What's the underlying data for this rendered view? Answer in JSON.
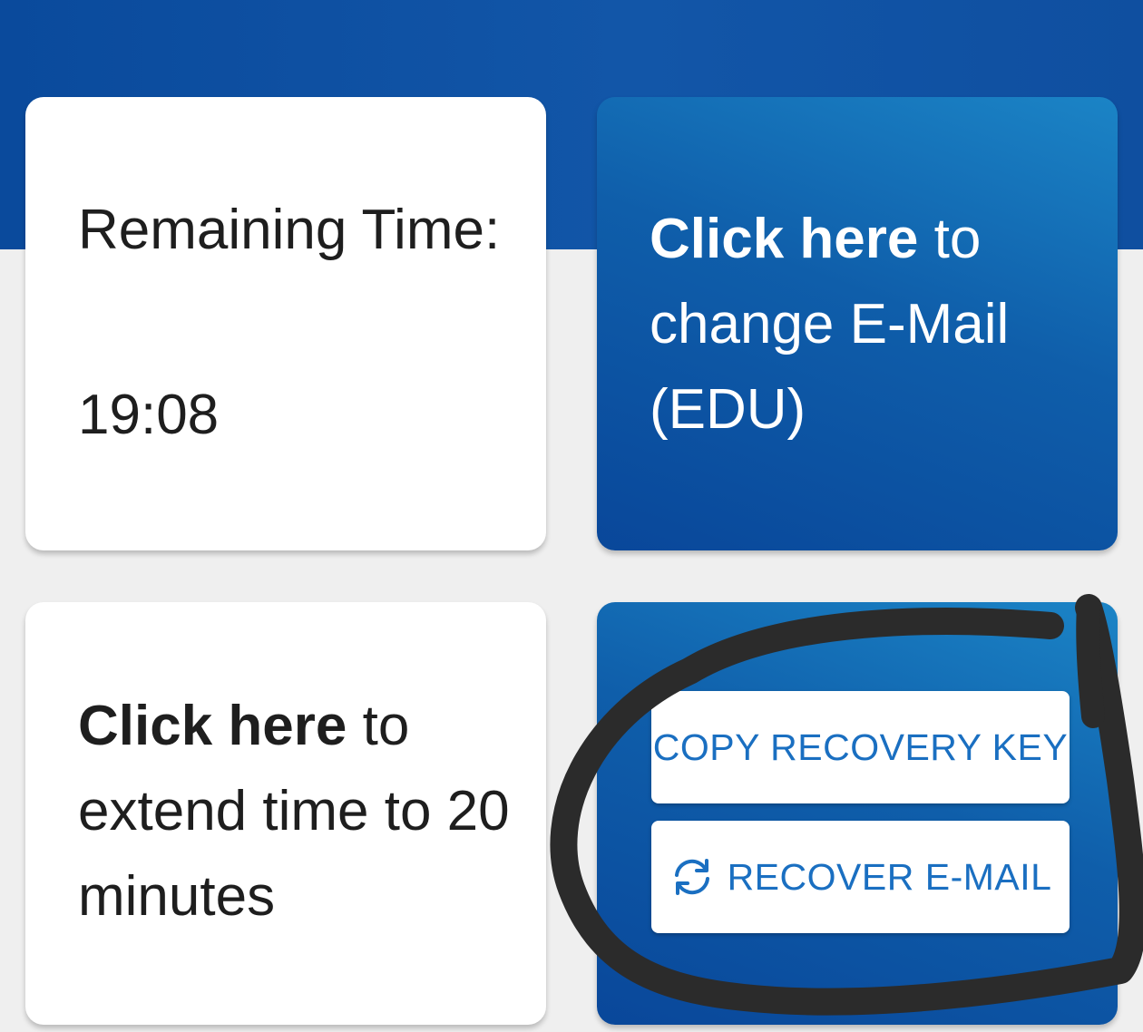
{
  "time_card": {
    "label": "Remaining Time:",
    "value": "19:08"
  },
  "email_card": {
    "bold": "Click here",
    "rest_line1": " to",
    "rest": "change E-Mail (EDU)"
  },
  "extend_card": {
    "bold": "Click here",
    "rest_line1": " to",
    "rest": "extend time to 20 minutes"
  },
  "recovery_card": {
    "copy_label": "COPY RECOVERY KEY",
    "recover_label": "RECOVER E-MAIL",
    "recover_icon": "refresh-icon"
  },
  "colors": {
    "primary_blue": "#0f5eaa",
    "button_text": "#1a6fc1",
    "annotation": "#2b2b2b"
  }
}
